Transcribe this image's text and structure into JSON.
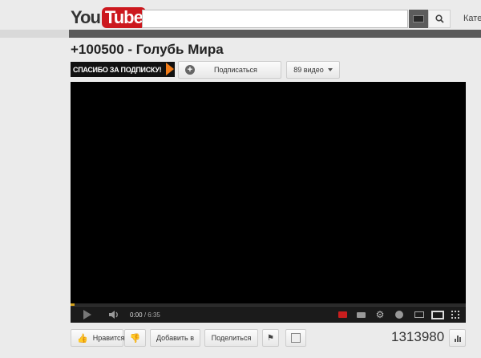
{
  "header": {
    "logo_you": "You",
    "logo_tube": "Tube",
    "search": {
      "value": "",
      "placeholder": ""
    },
    "categories_label": "Катег"
  },
  "video": {
    "title": "+100500 - Голубь Мира",
    "banner_text": "СПАСИБО ЗА ПОДПИСКУ!",
    "subscribe_label": "Подписаться",
    "videos_count_label": "89 видео",
    "time_current": "0:00",
    "time_separator": "/",
    "time_duration": "6:35",
    "progress_fraction": 0.01
  },
  "actions": {
    "like_label": "Нравится",
    "add_label": "Добавить в",
    "share_label": "Поделиться",
    "view_count": "1313980"
  },
  "icons": {
    "search": "search-icon",
    "keyboard": "keyboard-icon",
    "play": "play-icon",
    "volume": "volume-icon",
    "subtitles": "subtitles-icon",
    "annotations": "annotations-icon",
    "settings": "gear-icon",
    "watch_later": "clock-icon",
    "small_player": "small-player-icon",
    "large_player": "large-player-icon",
    "fullscreen": "fullscreen-icon",
    "like": "thumbs-up-icon",
    "dislike": "thumbs-down-icon",
    "flag": "flag-icon",
    "transcript": "transcript-icon",
    "stats": "stats-icon"
  },
  "colors": {
    "brand_red": "#cc181e",
    "progress": "#d4a21b",
    "banner_arrow": "#f07b18"
  }
}
